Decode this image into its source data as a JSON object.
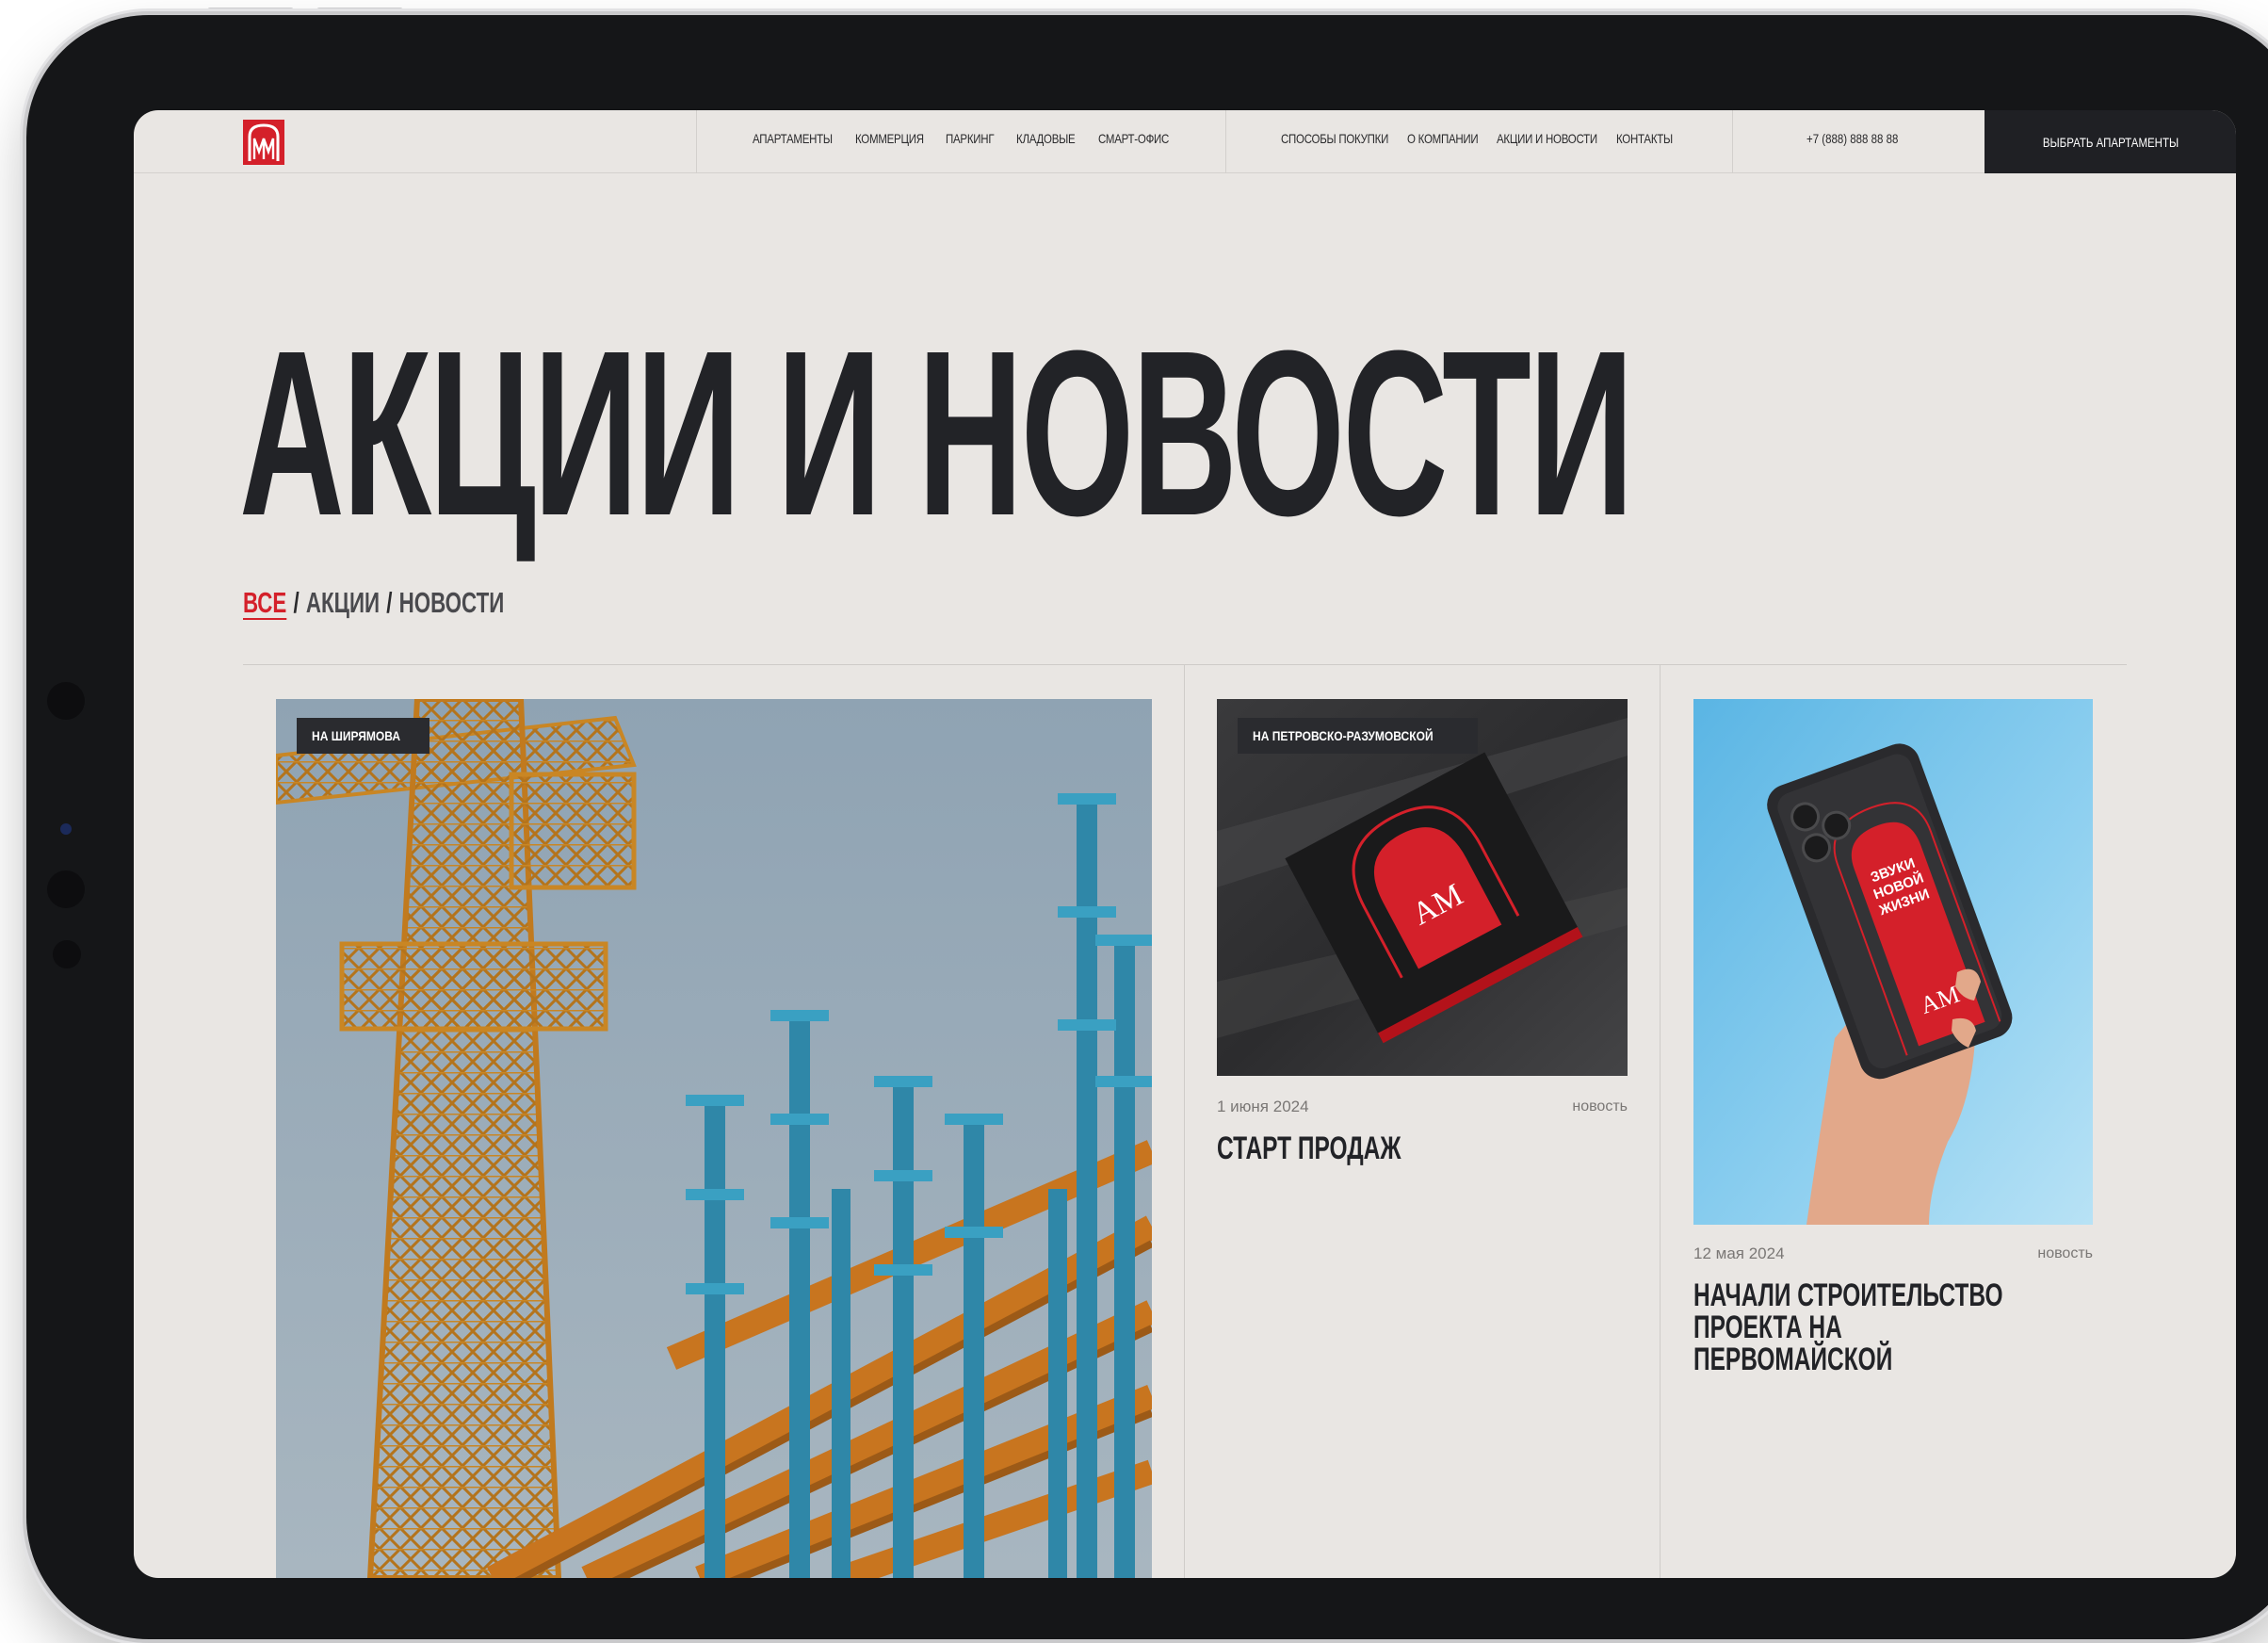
{
  "nav": {
    "logo_text": "AM",
    "links_left": [
      "АПАРТАМЕНТЫ",
      "КОММЕРЦИЯ",
      "ПАРКИНГ",
      "КЛАДОВЫЕ",
      "СМАРТ-ОФИС"
    ],
    "links_right": [
      "СПОСОБЫ ПОКУПКИ",
      "О КОМПАНИИ",
      "АКЦИИ И НОВОСТИ",
      "КОНТАКТЫ"
    ],
    "phone": "+7 (888) 888 88 88",
    "cta_label": "ВЫБРАТЬ АПАРТАМЕНТЫ"
  },
  "page_title": "АКЦИИ И НОВОСТИ",
  "filters": {
    "items": [
      "ВСЕ",
      "АКЦИИ",
      "НОВОСТИ"
    ],
    "separator": "/",
    "active": "ВСЕ"
  },
  "cards": [
    {
      "tag": "НА ШИРЯМОВА",
      "image": "construction-crane-photo"
    },
    {
      "tag": "НА ПЕТРОВСКО-РАЗУМОВСКОЙ",
      "image": "booklet-photo",
      "date": "1 июня 2024",
      "type": "новость",
      "title": "СТАРТ ПРОДАЖ"
    },
    {
      "image": "phone-case-photo",
      "phone_case_text": "ЗВУКИ НОВОЙ ЖИЗНИ",
      "date": "12 мая 2024",
      "type": "новость",
      "title": "НАЧАЛИ СТРОИТЕЛЬСТВО ПРОЕКТА НА ПЕРВОМАЙСКОЙ"
    }
  ],
  "colors": {
    "accent": "#d4202a",
    "background": "#e9e6e3",
    "dark": "#1f2024",
    "frame": "#151618"
  }
}
